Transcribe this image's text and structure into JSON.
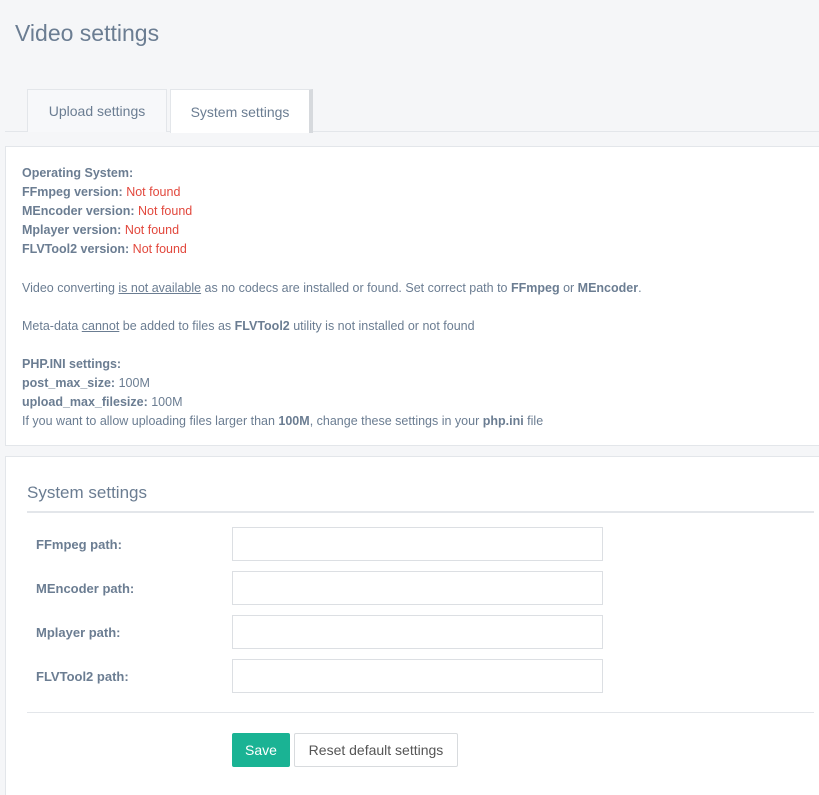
{
  "page": {
    "title": "Video settings"
  },
  "tabs": [
    {
      "label": "Upload settings",
      "active": false
    },
    {
      "label": "System settings",
      "active": true
    }
  ],
  "info": {
    "os_label": "Operating System:",
    "os_value": "",
    "ffmpeg_label": "FFmpeg version:",
    "ffmpeg_value": "Not found",
    "mencoder_label": "MEncoder version:",
    "mencoder_value": "Not found",
    "mplayer_label": "Mplayer version:",
    "mplayer_value": "Not found",
    "flvtool_label": "FLVTool2 version:",
    "flvtool_value": "Not found",
    "converting": {
      "prefix": "Video converting ",
      "underlined": "is not available",
      "middle": " as no codecs are installed or found. Set correct path to ",
      "ffmpeg": "FFmpeg",
      "or": " or ",
      "mencoder": "MEncoder",
      "suffix": "."
    },
    "metadata": {
      "prefix": "Meta-data ",
      "underlined": "cannot",
      "middle": " be added to files as ",
      "flvtool": "FLVTool2",
      "suffix": " utility is not installed or not found"
    },
    "php": {
      "heading": "PHP.INI settings:",
      "post_label": "post_max_size:",
      "post_value": " 100M",
      "upload_label": "upload_max_filesize:",
      "upload_value": " 100M",
      "note_prefix": "If you want to allow uploading files larger than ",
      "note_size": "100M",
      "note_middle": ", change these settings in your ",
      "note_file": "php.ini",
      "note_suffix": " file"
    }
  },
  "form": {
    "title": "System settings",
    "fields": [
      {
        "label": "FFmpeg path:",
        "value": ""
      },
      {
        "label": "MEncoder path:",
        "value": ""
      },
      {
        "label": "Mplayer path:",
        "value": ""
      },
      {
        "label": "FLVTool2 path:",
        "value": ""
      }
    ],
    "save_label": "Save",
    "reset_label": "Reset default settings",
    "accent_color": "#1ab394"
  }
}
